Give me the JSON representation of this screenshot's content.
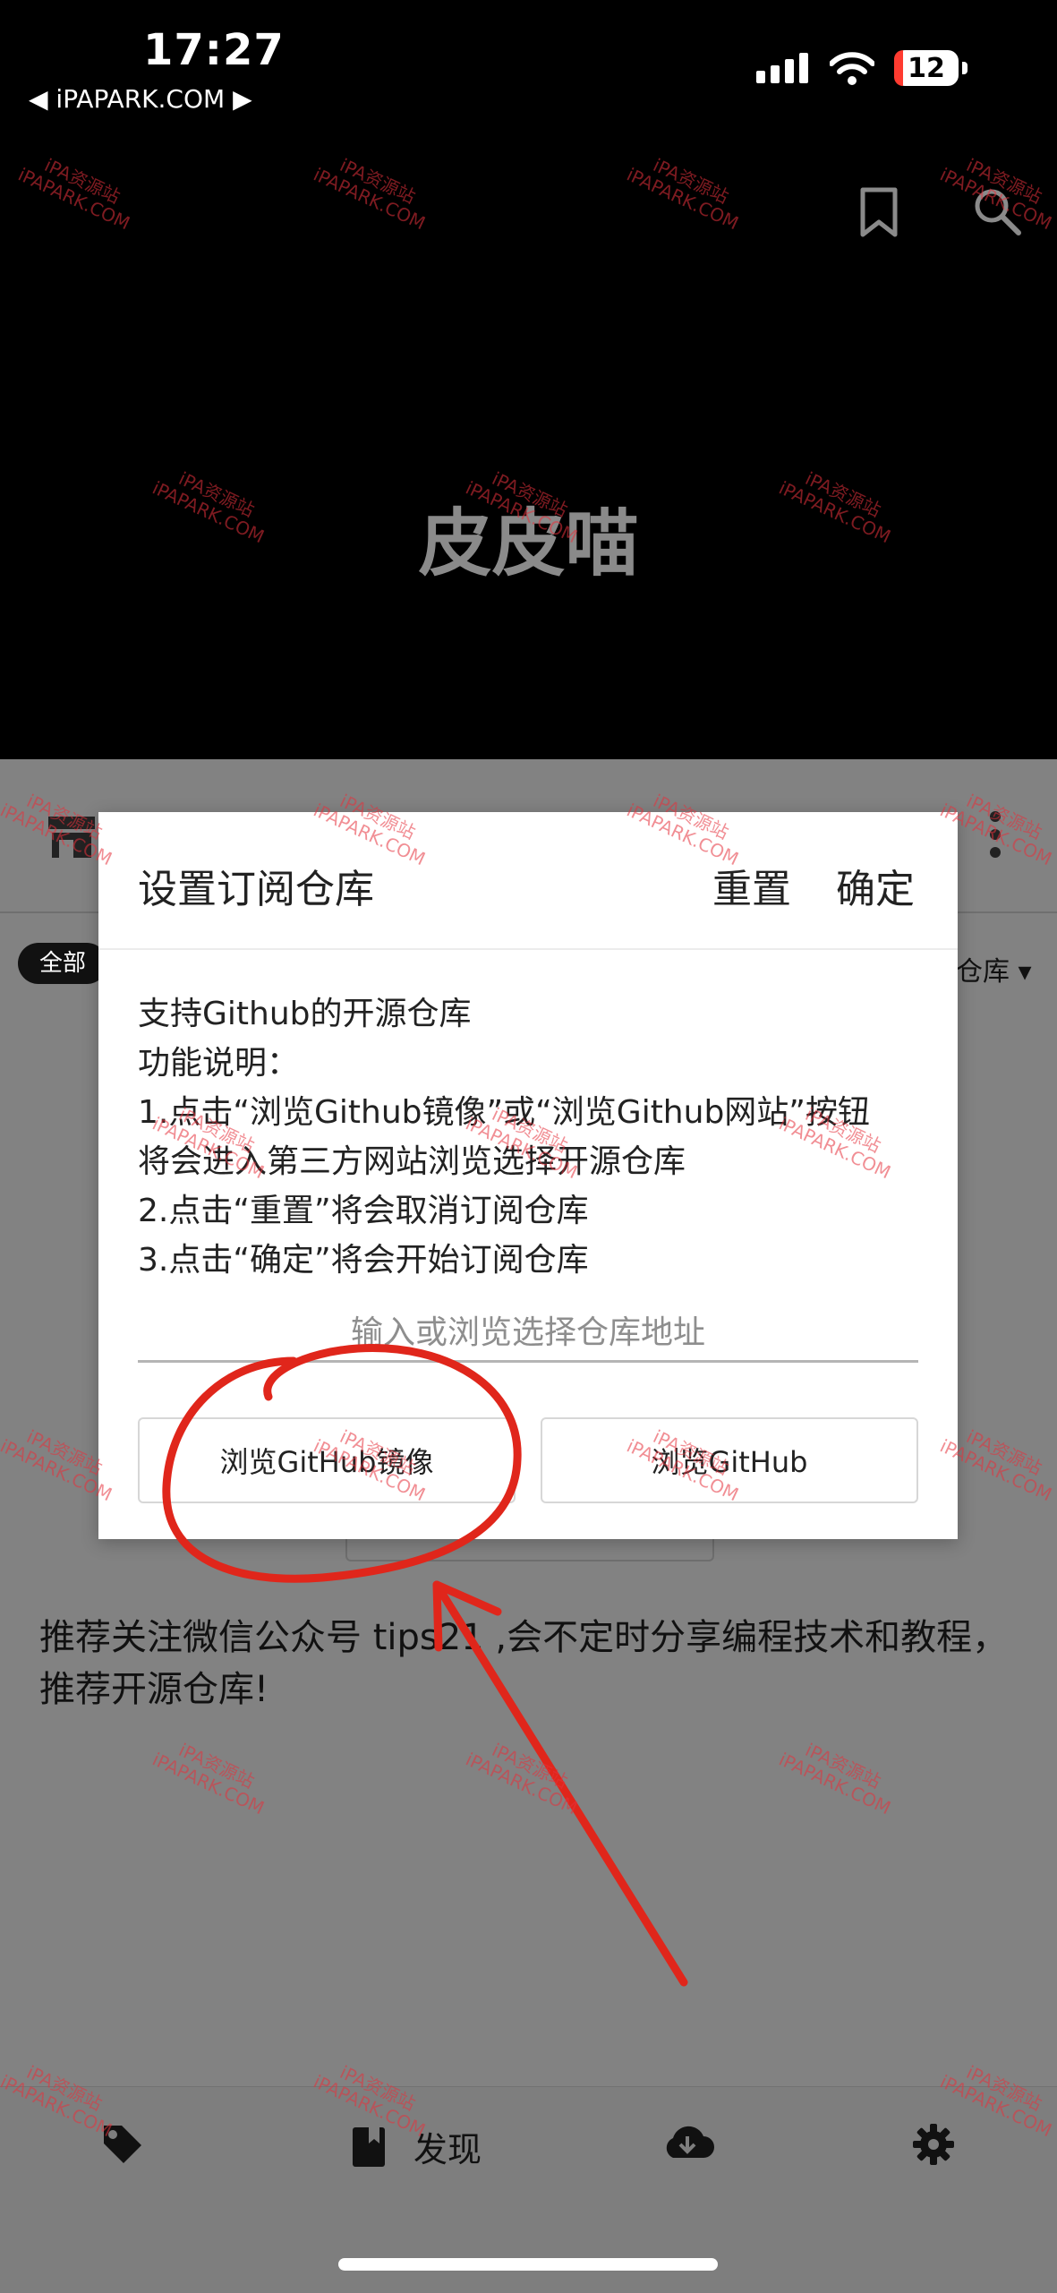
{
  "status_bar": {
    "time": "17:27",
    "back_link": "◀ iPAPARK.COM ▶",
    "battery": "12"
  },
  "app": {
    "title": "皮皮喵"
  },
  "filter": {
    "all_label": "全部",
    "repo_dropdown": "仓库 ▾"
  },
  "recommend_text": "推荐关注微信公众号 tips21 ,会不定时分享编程技术和教程，推荐开源仓库!",
  "dialog": {
    "title": "设置订阅仓库",
    "reset_label": "重置",
    "confirm_label": "确定",
    "description_lines": [
      "支持Github的开源仓库",
      "功能说明：",
      "1.点击“浏览Github镜像”或“浏览Github网站”按钮",
      "将会进入第三方网站浏览选择开源仓库",
      "2.点击“重置”将会取消订阅仓库",
      "3.点击“确定”将会开始订阅仓库"
    ],
    "input_placeholder": "输入或浏览选择仓库地址",
    "mirror_button": "浏览GitHub镜像",
    "github_button": "浏览GitHub"
  },
  "bottom_nav": {
    "discover_label": "发现"
  },
  "watermark": {
    "line1": "iPA资源站",
    "line2": "iPAPARK.COM"
  },
  "icons": [
    "bookmark-icon",
    "search-icon",
    "store-icon",
    "more-vert-icon",
    "tag-icon",
    "book-icon",
    "cloud-download-icon",
    "gear-icon"
  ],
  "colors": {
    "annotation_red": "#e0261b"
  }
}
